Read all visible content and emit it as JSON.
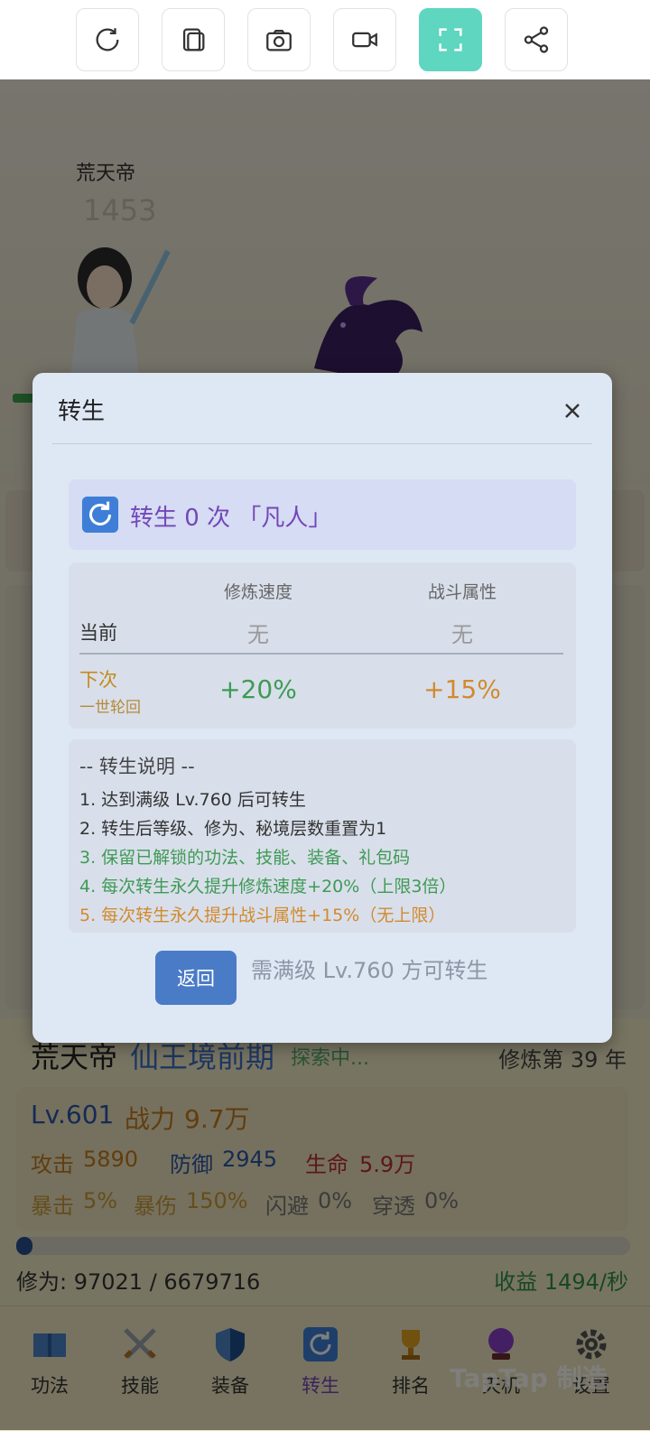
{
  "toolbar": {
    "icons": [
      "refresh-icon",
      "copy-icon",
      "camera-icon",
      "video-icon",
      "fullscreen-icon",
      "share-icon"
    ]
  },
  "battle": {
    "hero_name": "荒天帝",
    "hero_score": "1453"
  },
  "modal": {
    "title": "转生",
    "rebirth_title": "转生 0 次 「凡人」",
    "table": {
      "col_speed": "修炼速度",
      "col_combat": "战斗属性",
      "current_label": "当前",
      "current_speed": "无",
      "current_combat": "无",
      "next_label": "下次",
      "next_sub": "一世轮回",
      "next_speed": "+20%",
      "next_combat": "+15%"
    },
    "notes": {
      "title": "-- 转生说明 --",
      "items": [
        "1. 达到满级 Lv.760 后可转生",
        "2. 转生后等级、修为、秘境层数重置为1",
        "3. 保留已解锁的功法、技能、装备、礼包码",
        "4. 每次转生永久提升修炼速度+20%（上限3倍）",
        "5. 每次转生永久提升战斗属性+15%（无上限）"
      ]
    },
    "back_label": "返回",
    "requirement_hint": "需满级 Lv.760 方可转生"
  },
  "status": {
    "name": "荒天帝",
    "realm": "仙王境前期",
    "exploring": "探索中...",
    "year": "修炼第 39 年",
    "level": "Lv.601",
    "power_label": "战力",
    "power": "9.7万",
    "attack_label": "攻击",
    "attack": "5890",
    "defense_label": "防御",
    "defense": "2945",
    "hp_label": "生命",
    "hp": "5.9万",
    "crit_label": "暴击",
    "crit": "5%",
    "critdmg_label": "暴伤",
    "critdmg": "150%",
    "dodge_label": "闪避",
    "dodge": "0%",
    "pierce_label": "穿透",
    "pierce": "0%"
  },
  "progress": {
    "label": "修为: 97021 / 6679716",
    "fraction": 0.0145,
    "income": "收益 1494/秒"
  },
  "nav": {
    "items": [
      {
        "label": "功法",
        "icon": "book-icon"
      },
      {
        "label": "技能",
        "icon": "swords-icon"
      },
      {
        "label": "装备",
        "icon": "shield-icon"
      },
      {
        "label": "转生",
        "icon": "rebirth-icon"
      },
      {
        "label": "排名",
        "icon": "trophy-icon"
      },
      {
        "label": "天机",
        "icon": "crystal-ball-icon"
      },
      {
        "label": "设置",
        "icon": "gear-icon"
      }
    ],
    "watermark": "TapTap 制造"
  },
  "colors": {
    "accent": "#5ed6c0",
    "primary_button": "#4a7bc7",
    "rebirth_purple": "#7447b8",
    "green": "#3f9a55",
    "orange": "#d28a2e"
  }
}
